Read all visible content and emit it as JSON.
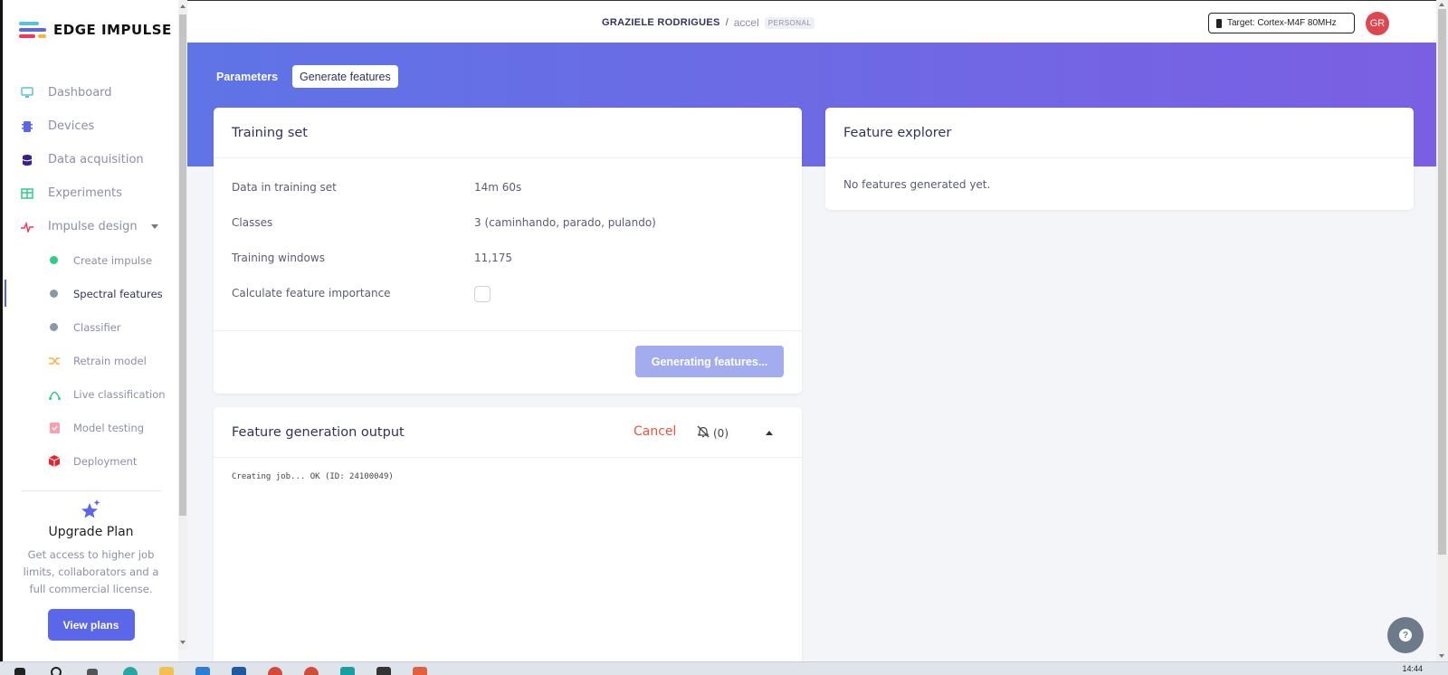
{
  "brand": {
    "name": "EDGE IMPULSE"
  },
  "header": {
    "user": "GRAZIELE RODRIGUES",
    "separator": "/",
    "project": "accel",
    "project_badge": "PERSONAL",
    "target": "Target: Cortex-M4F 80MHz",
    "avatar_initials": "GR"
  },
  "sidebar": {
    "items": [
      {
        "label": "Dashboard",
        "icon": "monitor-icon",
        "color": "#5bc0de"
      },
      {
        "label": "Devices",
        "icon": "chip-icon",
        "color": "#5a67e8"
      },
      {
        "label": "Data acquisition",
        "icon": "database-icon",
        "color": "#3b1e8c"
      },
      {
        "label": "Experiments",
        "icon": "table-icon",
        "color": "#2dce89"
      },
      {
        "label": "Impulse design",
        "icon": "pulse-icon",
        "color": "#f5365c"
      }
    ],
    "sub_items": [
      {
        "label": "Create impulse",
        "color": "#2dce89"
      },
      {
        "label": "Spectral features",
        "color": "#8898aa"
      },
      {
        "label": "Classifier",
        "color": "#8898aa"
      },
      {
        "label": "Retrain model",
        "color": "#fbb140"
      },
      {
        "label": "Live classification",
        "color": "#2dce89"
      },
      {
        "label": "Model testing",
        "color": "#f5365c"
      },
      {
        "label": "Deployment",
        "color": "#e0282e"
      }
    ]
  },
  "upgrade": {
    "title": "Upgrade Plan",
    "description": "Get access to higher job limits, collaborators and a full commercial license.",
    "button": "View plans"
  },
  "tabs": {
    "parameters": "Parameters",
    "generate": "Generate features"
  },
  "training_set": {
    "title": "Training set",
    "rows": [
      {
        "label": "Data in training set",
        "value": "14m 60s"
      },
      {
        "label": "Classes",
        "value": "3 (caminhando, parado, pulando)"
      },
      {
        "label": "Training windows",
        "value": "11,175"
      },
      {
        "label": "Calculate feature importance",
        "value": ""
      }
    ],
    "button": "Generating features..."
  },
  "feature_explorer": {
    "title": "Feature explorer",
    "empty": "No features generated yet."
  },
  "output": {
    "title": "Feature generation output",
    "cancel": "Cancel",
    "notifications": "(0)",
    "log": "Creating job... OK (ID: 24100049)"
  },
  "taskbar": {
    "clock": "14:44"
  }
}
